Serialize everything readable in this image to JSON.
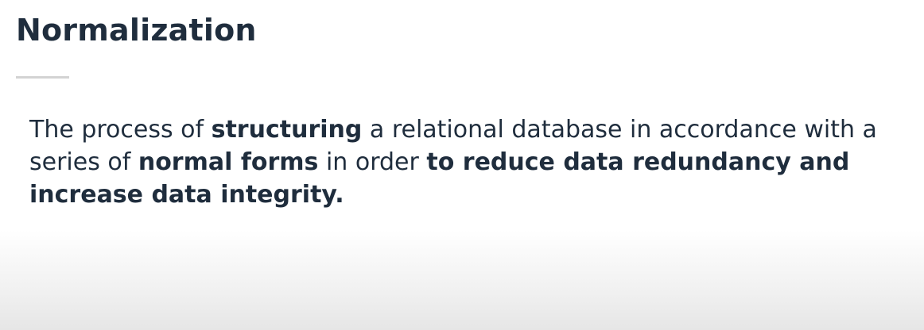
{
  "slide": {
    "title": "Normalization",
    "definition": [
      {
        "text": "The process of ",
        "bold": false
      },
      {
        "text": "structuring",
        "bold": true
      },
      {
        "text": " a relational database in accordance with a series of ",
        "bold": false
      },
      {
        "text": "normal forms",
        "bold": true
      },
      {
        "text": " in order ",
        "bold": false
      },
      {
        "text": "to reduce data redundancy and increase data integrity.",
        "bold": true
      }
    ]
  }
}
